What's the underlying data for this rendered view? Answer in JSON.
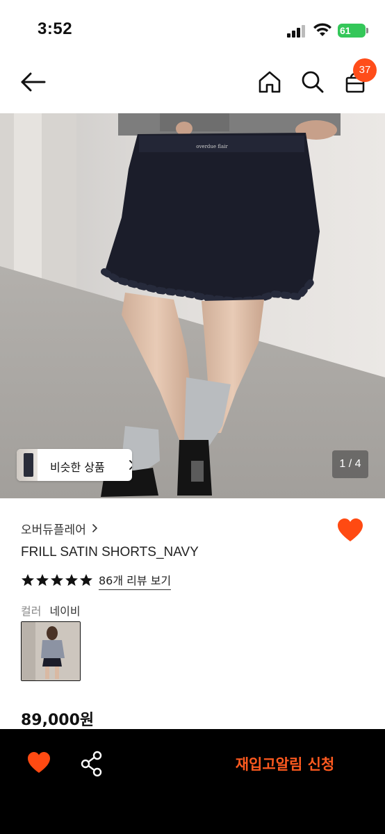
{
  "status_bar": {
    "time": "3:52",
    "battery": "61"
  },
  "header": {
    "back_icon": "arrow-left-icon",
    "home_icon": "home-icon",
    "search_icon": "search-icon",
    "cart_icon": "shopping-bag-icon",
    "cart_count": "37"
  },
  "gallery": {
    "similar_button_label": "비슷한 상품",
    "page_indicator": "1 / 4"
  },
  "product": {
    "brand": "오버듀플레어",
    "name": "FRILL SATIN SHORTS_NAVY",
    "rating": 5,
    "review_link": "86개 리뷰 보기",
    "option_label": "컬러",
    "option_value": "네이비",
    "price": "89,000원"
  },
  "bottom_bar": {
    "restock_label": "재입고알림 신청"
  },
  "colors": {
    "accent": "#ff4d1a",
    "restock_text": "#ff5a1f",
    "heart": "#ff4a12",
    "bottom_bar_bg": "#000000",
    "battery": "#34c759"
  }
}
